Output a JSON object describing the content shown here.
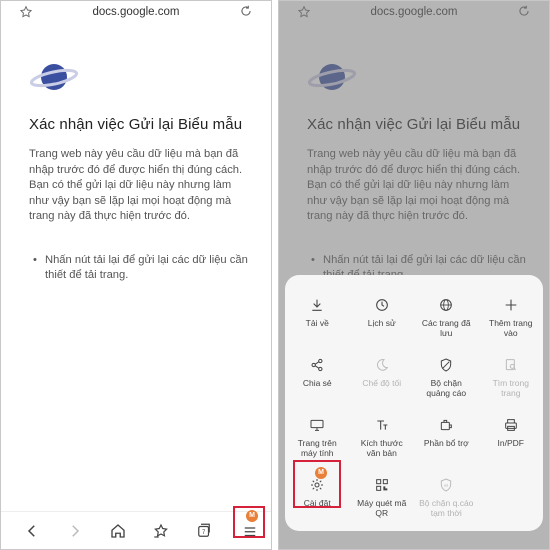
{
  "browser": {
    "url": "docs.google.com"
  },
  "page": {
    "title": "Xác nhận việc Gửi lại Biểu mẫu",
    "description": "Trang web này yêu cầu dữ liệu mà bạn đã nhập trước đó để được hiển thị đúng cách. Bạn có thể gửi lại dữ liệu này nhưng làm như vậy bạn sẽ lặp lại mọi hoạt động mà trang này đã thực hiện trước đó.",
    "bullet": "Nhấn nút tải lại để gửi lại các dữ liệu cần thiết để tải trang."
  },
  "bottom_nav": {
    "menu_badge": "M"
  },
  "menu": {
    "items": [
      {
        "label": "Tải về",
        "icon": "download-icon",
        "enabled": true
      },
      {
        "label": "Lịch sử",
        "icon": "history-icon",
        "enabled": true
      },
      {
        "label": "Các trang đã lưu",
        "icon": "globe-icon",
        "enabled": true
      },
      {
        "label": "Thêm trang vào",
        "icon": "plus-icon",
        "enabled": true
      },
      {
        "label": "Chia sẻ",
        "icon": "share-icon",
        "enabled": true
      },
      {
        "label": "Chế độ tối",
        "icon": "moon-icon",
        "enabled": false
      },
      {
        "label": "Bộ chặn quảng cáo",
        "icon": "shield-icon",
        "enabled": true
      },
      {
        "label": "Tìm trong trang",
        "icon": "find-icon",
        "enabled": false
      },
      {
        "label": "Trang trên máy tính",
        "icon": "desktop-icon",
        "enabled": true
      },
      {
        "label": "Kích thước văn bản",
        "icon": "text-size-icon",
        "enabled": true
      },
      {
        "label": "Phần bổ trợ",
        "icon": "addon-icon",
        "enabled": true
      },
      {
        "label": "In/PDF",
        "icon": "print-icon",
        "enabled": true
      },
      {
        "label": "Cài đặt",
        "icon": "gear-icon",
        "enabled": true
      },
      {
        "label": "Máy quét mã QR",
        "icon": "qr-icon",
        "enabled": true
      },
      {
        "label": "Bộ chặn q.cáo tạm thời",
        "icon": "shield-ad-icon",
        "enabled": false
      }
    ],
    "settings_badge": "M"
  },
  "colors": {
    "highlight": "#d6213b",
    "badge": "#e8803a",
    "planet": "#3b4fa0"
  }
}
